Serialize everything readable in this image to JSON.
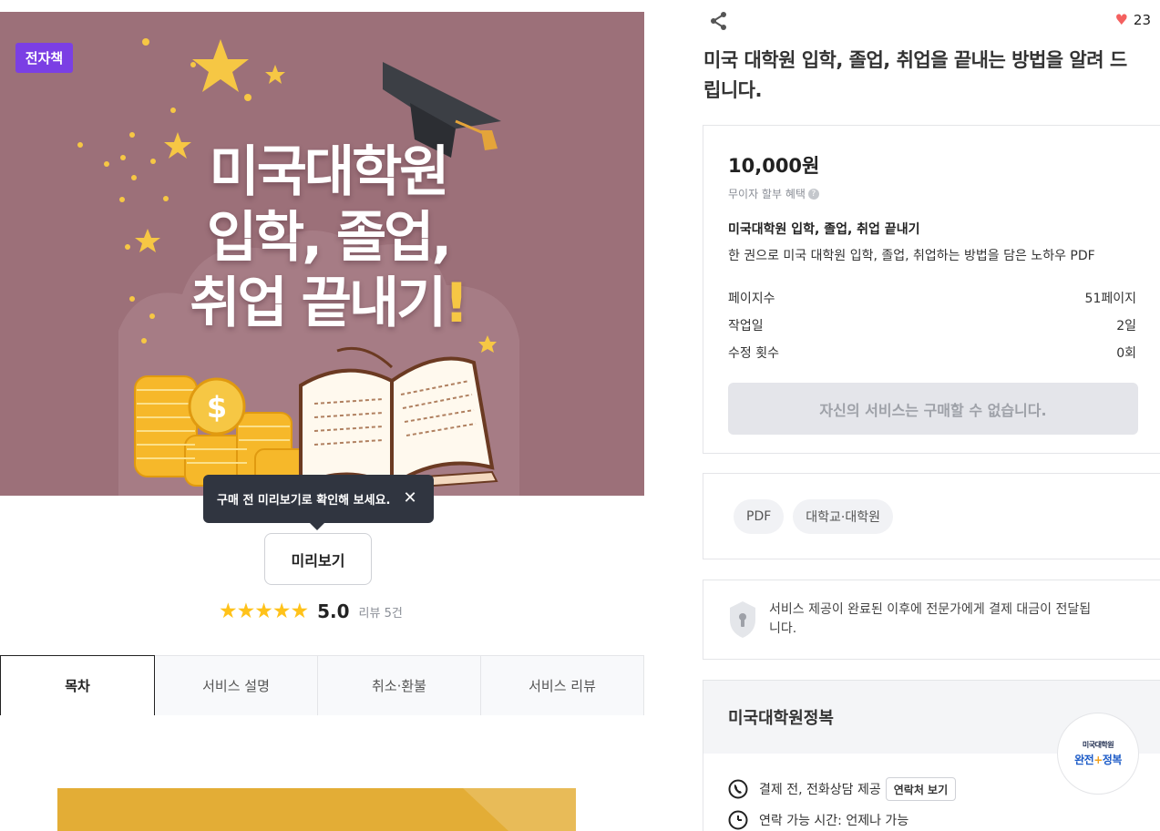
{
  "cover": {
    "badge": "전자책",
    "title_line1": "미국대학원",
    "title_line2": "입학, 졸업,",
    "title_line3": "취업 끝내기",
    "title_excl": "!"
  },
  "preview": {
    "tooltip_text": "구매 전 미리보기로 확인해 보세요.",
    "close_glyph": "✕",
    "button_label": "미리보기"
  },
  "rating": {
    "stars": "★★★★★",
    "score": "5.0",
    "review_text": "리뷰 5건"
  },
  "tabs": [
    {
      "label": "목차",
      "active": true
    },
    {
      "label": "서비스 설명",
      "active": false
    },
    {
      "label": "취소·환불",
      "active": false
    },
    {
      "label": "서비스 리뷰",
      "active": false
    }
  ],
  "header": {
    "like_count": "23",
    "title": "미국 대학원 입학, 졸업, 취업을 끝내는 방법을 알려 드립니다."
  },
  "price_card": {
    "price": "10,000원",
    "installment": "무이자 할부 혜택",
    "package_name": "미국대학원 입학, 졸업, 취업 끝내기",
    "package_desc": "한 권으로 미국 대학원 입학, 졸업, 취업하는 방법을 담은 노하우 PDF",
    "specs": [
      {
        "label": "페이지수",
        "value": "51페이지"
      },
      {
        "label": "작업일",
        "value": "2일"
      },
      {
        "label": "수정 횟수",
        "value": "0회"
      }
    ],
    "buy_button": "자신의 서비스는 구매할 수 없습니다."
  },
  "tags": [
    "PDF",
    "대학교·대학원"
  ],
  "notice": {
    "text": "서비스 제공이 완료된 이후에 전문가에게 결제 대금이 전달됩니다."
  },
  "expert": {
    "name": "미국대학원정복",
    "avatar_line1": "미국대학원",
    "avatar_line2_a": "완전",
    "avatar_line2_plus": "+",
    "avatar_line2_b": "정복",
    "row1_text": "결제 전, 전화상담 제공",
    "contact_button": "연락처 보기",
    "row2_text": "연락 가능 시간: 언제나 가능"
  },
  "colors": {
    "cover_bg": "#9c7079",
    "badge_bg": "#7b3fe4",
    "star": "#ffc21a",
    "heart": "#f4605f",
    "toc_bar": "#e3ad36"
  }
}
